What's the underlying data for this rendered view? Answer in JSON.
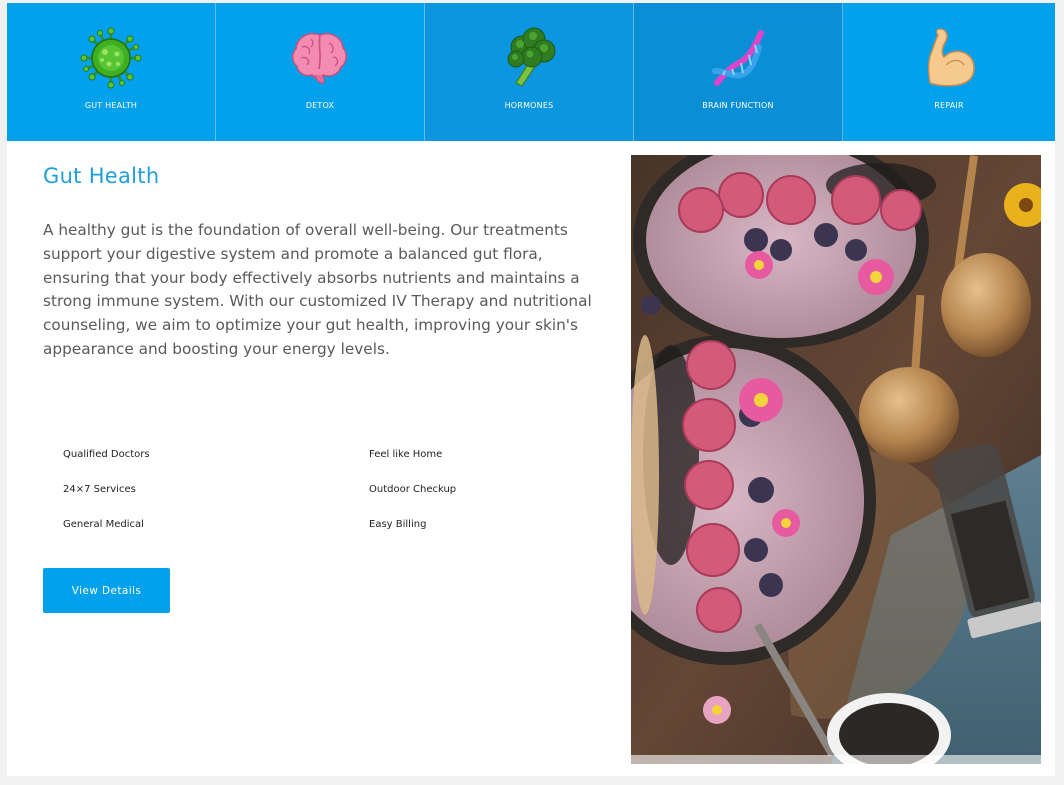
{
  "tabs": [
    {
      "label": "GUT HEALTH",
      "icon": "virus-icon"
    },
    {
      "label": "DETOX",
      "icon": "brain-icon"
    },
    {
      "label": "HORMONES",
      "icon": "broccoli-icon"
    },
    {
      "label": "BRAIN FUNCTION",
      "icon": "dna-icon"
    },
    {
      "label": "REPAIR",
      "icon": "flexed-biceps-icon"
    }
  ],
  "content": {
    "title": "Gut Health",
    "description": "A healthy gut is the foundation of overall well-being. Our treatments support your digestive system and promote a balanced gut flora, ensuring that your body effectively absorbs nutrients and maintains a strong immune system. With our customized IV Therapy and nutritional counseling, we aim to optimize your gut health, improving your skin's appearance and boosting your energy levels.",
    "features": [
      "Qualified Doctors",
      "Feel like Home",
      "24×7 Services",
      "Outdoor Checkup",
      "General Medical",
      "Easy Billing"
    ],
    "button_label": "View Details"
  },
  "colors": {
    "accent": "#03a0eb",
    "title": "#1e9fdc",
    "text": "#5a5a5a"
  }
}
